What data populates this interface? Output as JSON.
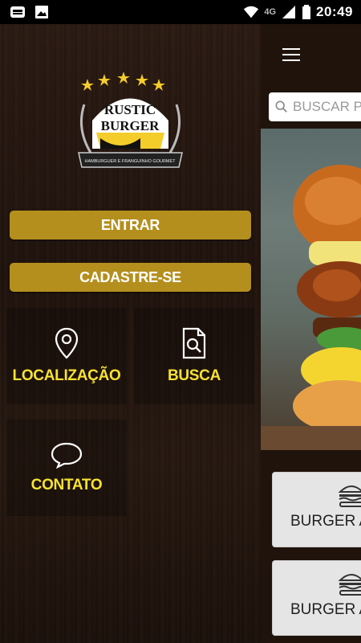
{
  "status_bar": {
    "time": "20:49",
    "network": "4G",
    "icons": [
      "notification-app-icon",
      "image-icon",
      "wifi-icon",
      "signal-icon",
      "battery-icon"
    ]
  },
  "drawer": {
    "logo": {
      "line1": "RUSTIC",
      "line2": "BURGER",
      "tagline": "HAMBURGUER E FRANGUINHO GOURMET"
    },
    "buttons": {
      "login": "ENTRAR",
      "signup": "CADASTRE-SE"
    },
    "tiles": [
      {
        "label": "LOCALIZAÇÃO",
        "icon": "location-pin-icon"
      },
      {
        "label": "BUSCA",
        "icon": "document-search-icon"
      },
      {
        "label": "CONTATO",
        "icon": "chat-bubble-icon"
      }
    ]
  },
  "main": {
    "search_placeholder": "BUSCAR PR",
    "categories": [
      {
        "label": "BURGER AR"
      },
      {
        "label": "BURGER AM"
      }
    ]
  },
  "colors": {
    "button_gold": "#b48f1e",
    "tile_text_yellow": "#f7e231",
    "background_wood": "#241710"
  }
}
